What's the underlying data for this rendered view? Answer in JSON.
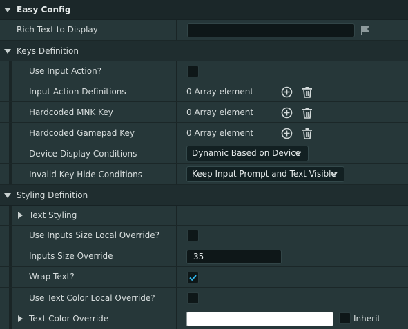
{
  "sections": {
    "easy_config": {
      "title": "Easy Config"
    },
    "keys_definition": {
      "title": "Keys Definition"
    },
    "styling_definition": {
      "title": "Styling Definition"
    }
  },
  "rows": {
    "rich_text": {
      "label": "Rich Text to Display",
      "value": ""
    },
    "use_input_action": {
      "label": "Use Input Action?",
      "checked": false
    },
    "input_action_definitions": {
      "label": "Input Action Definitions",
      "value": "0 Array element"
    },
    "hardcoded_mnk_key": {
      "label": "Hardcoded MNK Key",
      "value": "0 Array element"
    },
    "hardcoded_gamepad_key": {
      "label": "Hardcoded Gamepad Key",
      "value": "0 Array element"
    },
    "device_display_conditions": {
      "label": "Device Display Conditions",
      "value": "Dynamic Based on Device"
    },
    "invalid_key_hide_conditions": {
      "label": "Invalid Key Hide Conditions",
      "value": "Keep Input Prompt and Text Visible"
    },
    "text_styling": {
      "label": "Text Styling"
    },
    "use_inputs_size_override": {
      "label": "Use Inputs Size Local Override?",
      "checked": false
    },
    "inputs_size_override": {
      "label": "Inputs Size Override",
      "value": "35"
    },
    "wrap_text": {
      "label": "Wrap Text?",
      "checked": true
    },
    "use_text_color_override": {
      "label": "Use Text Color Local Override?",
      "checked": false
    },
    "text_color_override": {
      "label": "Text Color Override",
      "color": "#ffffff",
      "inherit_label": "Inherit",
      "inherit_checked": false
    }
  },
  "icons": {
    "expanded": "chevron-down-icon",
    "collapsed": "chevron-right-icon",
    "add": "plus-circle-icon",
    "delete": "trash-icon",
    "flag": "flag-icon",
    "check": "checkmark-icon"
  },
  "colors": {
    "panel_bg": "#243436",
    "header_bg": "#1f2d2f",
    "input_bg": "#0e1718",
    "check_accent": "#2fb4e8"
  }
}
